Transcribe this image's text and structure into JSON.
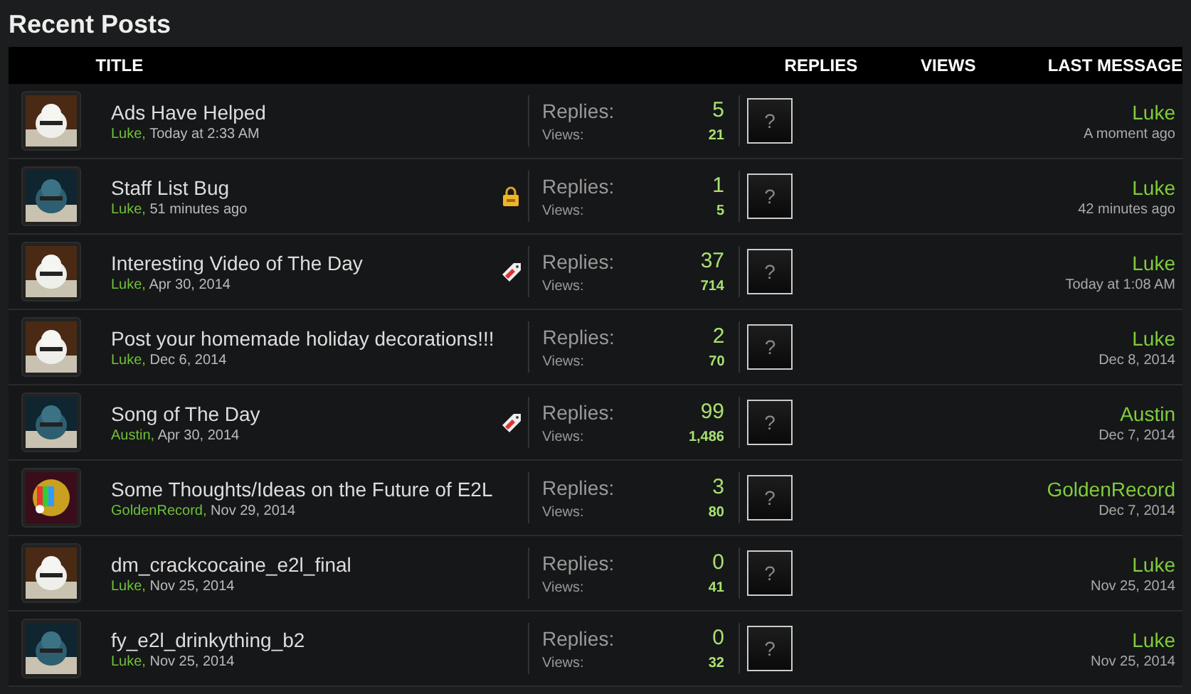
{
  "heading": "Recent Posts",
  "columns": [
    "TITLE",
    "REPLIES",
    "VIEWS",
    "LAST MESSAGE"
  ],
  "threads": [
    {
      "kind": "plain",
      "title": "Ads Have Helped",
      "author": "Luke,",
      "date": "Today at 2:33 AM",
      "replies_label": "Replies:",
      "replies": "5",
      "views_label": "Views:",
      "views": "21",
      "last_avatar": "?",
      "last_user": "Luke",
      "last_date": "A moment ago"
    },
    {
      "kind": "locked",
      "title": "Staff List Bug",
      "author": "Luke,",
      "date": "51 minutes ago",
      "replies_label": "Replies:",
      "replies": "1",
      "views_label": "Views:",
      "views": "5",
      "last_avatar": "?",
      "last_user": "Luke",
      "last_date": "42 minutes ago"
    },
    {
      "kind": "tagged",
      "title": "Interesting Video of The Day",
      "author": "Luke,",
      "date": "Apr 30, 2014",
      "replies_label": "Replies:",
      "replies": "37",
      "views_label": "Views:",
      "views": "714",
      "last_avatar": "?",
      "last_user": "Luke",
      "last_date": "Today at 1:08 AM"
    },
    {
      "kind": "plain",
      "title": "Post your homemade holiday decorations!!!",
      "author": "Luke,",
      "date": "Dec 6, 2014",
      "replies_label": "Replies:",
      "replies": "2",
      "views_label": "Views:",
      "views": "70",
      "last_avatar": "?",
      "last_user": "Luke",
      "last_date": "Dec 8, 2014"
    },
    {
      "kind": "tagged",
      "title": "Song of The Day",
      "author": "Austin,",
      "date": "Apr 30, 2014",
      "replies_label": "Replies:",
      "replies": "99",
      "views_label": "Views:",
      "views": "1,486",
      "last_avatar": "?",
      "last_user": "Austin",
      "last_date": "Dec 7, 2014"
    },
    {
      "kind": "plain",
      "title": "Some Thoughts/Ideas on the Future of E2L",
      "author": "GoldenRecord,",
      "date": "Nov 29, 2014",
      "replies_label": "Replies:",
      "replies": "3",
      "views_label": "Views:",
      "views": "80",
      "last_avatar": "?",
      "last_user": "GoldenRecord",
      "last_date": "Dec 7, 2014"
    },
    {
      "kind": "plain",
      "title": "dm_crackcocaine_e2l_final",
      "author": "Luke,",
      "date": "Nov 25, 2014",
      "replies_label": "Replies:",
      "replies": "0",
      "views_label": "Views:",
      "views": "41",
      "last_avatar": "?",
      "last_user": "Luke",
      "last_date": "Nov 25, 2014"
    },
    {
      "kind": "plain",
      "title": "fy_e2l_drinkything_b2",
      "author": "Luke,",
      "date": "Nov 25, 2014",
      "replies_label": "Replies:",
      "replies": "0",
      "views_label": "Views:",
      "views": "32",
      "last_avatar": "?",
      "last_user": "Luke",
      "last_date": "Nov 25, 2014"
    }
  ]
}
